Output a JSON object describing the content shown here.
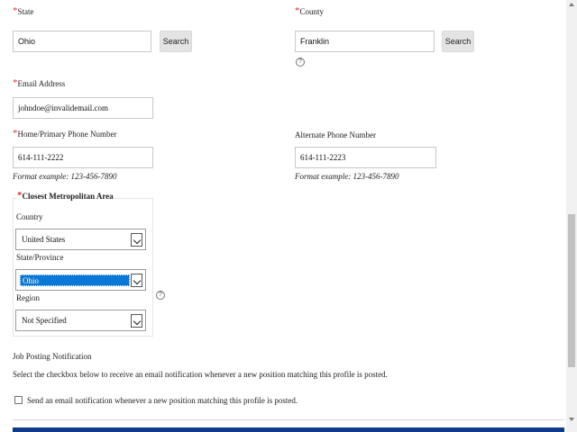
{
  "state": {
    "label": "State",
    "value": "Ohio",
    "search_label": "Search"
  },
  "county": {
    "label": "County",
    "value": "Franklin",
    "search_label": "Search",
    "help": "?"
  },
  "email": {
    "label": "Email Address",
    "value": "johndoe@invalidemail.com"
  },
  "home_phone": {
    "label": "Home/Primary Phone Number",
    "value": "614-111-2222",
    "format": "Format example:  123-456-7890"
  },
  "alt_phone": {
    "label": "Alternate Phone Number",
    "value": "614-111-2223",
    "format": "Format example:  123-456-7890"
  },
  "metro": {
    "legend": "Closest Metropolitan Area",
    "country_label": "Country",
    "country_value": "United States",
    "state_label": "State/Province",
    "state_value": "Ohio",
    "region_label": "Region",
    "region_value": "Not Specified",
    "help": "?"
  },
  "job_posting": {
    "heading": "Job Posting Notification",
    "description": "Select the checkbox below to receive an email notification whenever a new position matching this profile is posted.",
    "checkbox_label": "Send an email notification whenever a new position matching this profile is posted."
  },
  "required_marker": "*"
}
